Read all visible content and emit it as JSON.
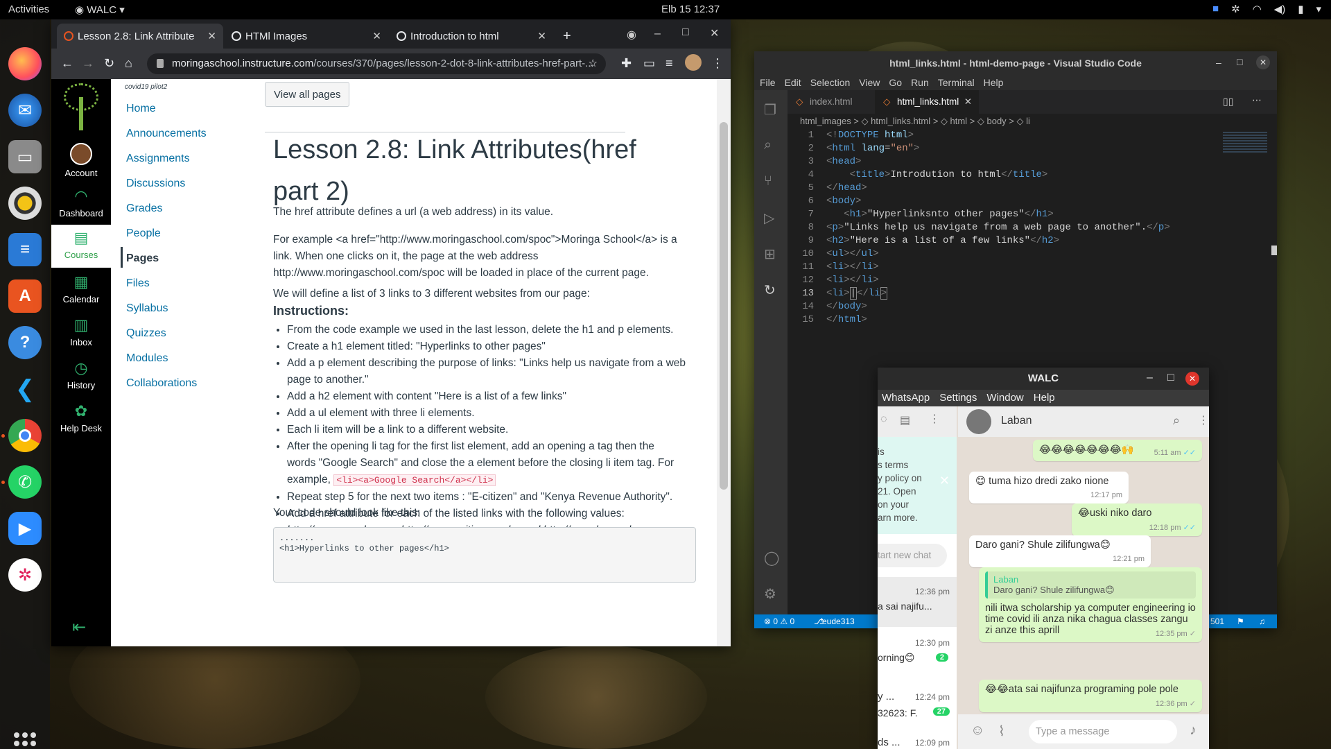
{
  "topbar": {
    "activities": "Activities",
    "app_menu": "WALC",
    "clock": "Elb 15  12:37"
  },
  "chrome": {
    "tabs": [
      {
        "title": "Lesson 2.8: Link Attribute"
      },
      {
        "title": "HTMl Images"
      },
      {
        "title": "Introduction to html"
      }
    ],
    "url_host": "moringaschool.instructure.com",
    "url_path": "/courses/370/pages/lesson-2-dot-8-link-attributes-href-part-..."
  },
  "canvas": {
    "global_nav": [
      {
        "label": "Account"
      },
      {
        "label": "Dashboard"
      },
      {
        "label": "Courses"
      },
      {
        "label": "Calendar"
      },
      {
        "label": "Inbox"
      },
      {
        "label": "History"
      },
      {
        "label": "Help Desk"
      }
    ],
    "course_code": "covid19 pilot2",
    "course_nav": [
      "Home",
      "Announcements",
      "Assignments",
      "Discussions",
      "Grades",
      "People",
      "Pages",
      "Files",
      "Syllabus",
      "Quizzes",
      "Modules",
      "Collaborations"
    ],
    "view_all_pages": "View all pages",
    "title_line1": "Lesson 2.8: Link Attributes(href",
    "title_line2": "part 2)",
    "p1": "The href attribute defines a url (a web address) in its value.",
    "p2a": "For example <a href=\"http://www.moringaschool.com/spoc\">Moringa School</a> is a",
    "p2b": "link. When one clicks on it, the page at the web address",
    "p2c": "http://www.moringaschool.com/spoc will be loaded in place of the current page.",
    "p3": "We will define a list of 3 links to 3 different websites from our page:",
    "instructions_heading": "Instructions:",
    "steps": [
      "From the code example we used in the last lesson, delete the h1 and p elements.",
      "Create a h1 element titled: \"Hyperlinks to other pages\"",
      "Add a p element describing the purpose of links: \"Links help us navigate from a web",
      "page to another.\"",
      "Add a h2 element with content \"Here is a list of a few links\"",
      "Add a ul element with three li elements.",
      "Each li item will be a link to a different website.",
      "After the opening li tag for the first list element, add an opening a tag then the",
      "words \"Google Search\" and close the a element before the closing li item tag. For",
      "example,",
      "Repeat step 5 for the next two items : \"E-citizen\" and \"Kenya Revenue Authority\".",
      "Add a href attribute for each of the listed links with the following values:"
    ],
    "example_code": "<li><a>Google Search</a></li>",
    "href_values": "http://www.google.com, http://www.ecitizen.go.ke and http://www.kra.go.ke.",
    "code_look": "Your code should look like this:",
    "code_block": ".......\n<h1>Hyperlinks to other pages</h1>"
  },
  "vscode": {
    "title": "html_links.html - html-demo-page - Visual Studio Code",
    "menu": [
      "File",
      "Edit",
      "Selection",
      "View",
      "Go",
      "Run",
      "Terminal",
      "Help"
    ],
    "tabs": [
      "index.html",
      "html_links.html"
    ],
    "breadcrumb": "html_images  >  ◇ html_links.html  >  ◇ html  >  ◇ body  >  ◇ li",
    "status_left": "⊗ 0 ⚠ 0",
    "status_branch": "eude313",
    "status_right": "501"
  },
  "walc": {
    "title": "WALC",
    "menu": [
      "WhatsApp",
      "Settings",
      "Window",
      "Help"
    ],
    "contact": "Laban",
    "left_snippets": [
      "is",
      "s terms",
      "y policy on",
      "21. Open",
      "on your",
      "arn more."
    ],
    "start_new_chat": "tart new chat",
    "chat_list": [
      {
        "time": "12:36 pm",
        "preview": "a sai najifu..."
      },
      {
        "time": "12:30 pm",
        "preview": "orning😊",
        "badge": "2"
      },
      {
        "time": "12:24 pm",
        "name": "y ...",
        "preview": "32623: F.",
        "badge": "27"
      },
      {
        "time": "12:09 pm",
        "name": "ds ..."
      }
    ],
    "messages": [
      {
        "text": "😂😂😂😂😂😂😂🙌",
        "time": "5:11 am"
      },
      {
        "text": "😊 tuma hizo dredi zako nione",
        "time": "12:17 pm"
      },
      {
        "text": "😂uski niko daro",
        "time": "12:18 pm"
      },
      {
        "text": "Daro gani? Shule zilifungwa😊",
        "time": "12:21 pm"
      },
      {
        "quote_name": "Laban",
        "quote": "Daro gani? Shule zilifungwa😊",
        "text": "nili itwa scholarship ya computer engineering io time covid ili anza nika chagua classes zangu zi anze this aprill",
        "time": "12:35 pm"
      },
      {
        "text": "😂😂ata sai najifunza programing pole pole",
        "time": "12:36 pm"
      }
    ],
    "placeholder": "Type a message"
  }
}
